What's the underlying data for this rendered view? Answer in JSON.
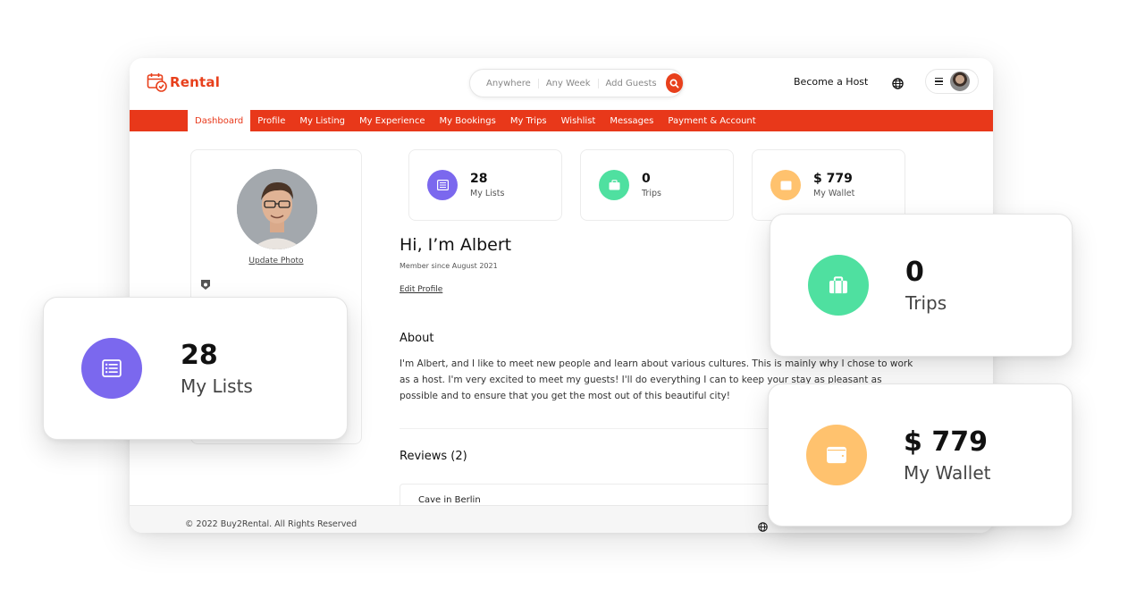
{
  "app": {
    "logo_text": "Rental"
  },
  "search": {
    "where": "Anywhere",
    "when": "Any Week",
    "guests": "Add Guests"
  },
  "header": {
    "become_host": "Become a Host"
  },
  "nav": {
    "items": [
      {
        "label": "Dashboard",
        "active": true
      },
      {
        "label": "Profile"
      },
      {
        "label": "My Listing"
      },
      {
        "label": "My Experience"
      },
      {
        "label": "My Bookings"
      },
      {
        "label": "My Trips"
      },
      {
        "label": "Wishlist"
      },
      {
        "label": "Messages"
      },
      {
        "label": "Payment & Account"
      }
    ]
  },
  "profile": {
    "update_photo": "Update Photo",
    "greeting": "Hi, I’m Albert",
    "member_since": "Member since August 2021",
    "edit_profile": "Edit Profile",
    "about_heading": "About",
    "about_text": "I'm Albert, and I like to meet new people and learn about various cultures. This is mainly why I chose to work as a host. I'm very excited to meet my guests! I'll do everything I can to keep your stay as pleasant as possible and to ensure that you get the most out of this beautiful city!",
    "reviews_heading": "Reviews (2)",
    "first_review_title": "Cave in Berlin"
  },
  "stats": [
    {
      "value": "28",
      "label": "My Lists",
      "icon": "list-icon",
      "color": "#7b68ee"
    },
    {
      "value": "0",
      "label": "Trips",
      "icon": "suitcase-icon",
      "color": "#4fe0a0"
    },
    {
      "value": "$ 779",
      "label": "My Wallet",
      "icon": "wallet-icon",
      "color": "#ffc26e"
    }
  ],
  "footer": {
    "copyright": "© 2022 Buy2Rental. All Rights Reserved"
  },
  "colors": {
    "brand": "#e8381a",
    "lists": "#7b68ee",
    "trips": "#4fe0a0",
    "wallet": "#ffc26e"
  }
}
